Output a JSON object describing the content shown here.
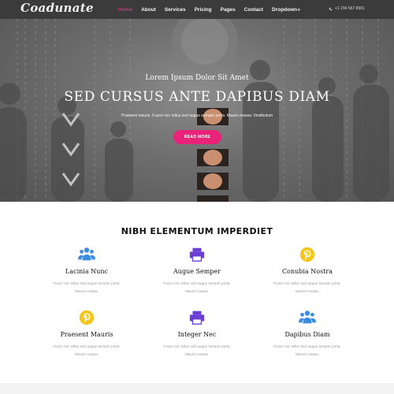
{
  "brand": {
    "logo": "Coadunate",
    "accent": "#e9237a",
    "nav_bg": "#3c3b3c"
  },
  "nav": {
    "items": [
      {
        "label": "Home",
        "active": true
      },
      {
        "label": "About"
      },
      {
        "label": "Services"
      },
      {
        "label": "Pricing"
      },
      {
        "label": "Pages"
      },
      {
        "label": "Contact"
      },
      {
        "label": "Dropdown"
      }
    ],
    "dropdown_caret": "▾",
    "phone": "+1 234 567 8901",
    "phone_icon": "phone-icon"
  },
  "hero": {
    "subtitle": "Lorem Ipsum Dolor Sit Amet",
    "title": "SED CURSUS ANTE DAPIBUS DIAM",
    "description": "Praesent mauris. Fusce nec tellus sed augue semper porta. Mauris massa. Vestibulum",
    "button_label": "READ MORE"
  },
  "features": {
    "title": "NIBH ELEMENTUM IMPERDIET",
    "items": [
      {
        "name": "Lacinia Nunc",
        "icon": "users-icon",
        "color": "#3a8de0",
        "desc": "Fusce nec tellus sed augue semper porta. Mauris massa."
      },
      {
        "name": "Augue Semper",
        "icon": "printer-icon",
        "color": "#6b3fd6",
        "desc": "Fusce nec tellus sed augue semper porta. Mauris massa."
      },
      {
        "name": "Conubia Nostra",
        "icon": "pinterest-icon",
        "color": "#f4c61a",
        "desc": "Fusce nec tellus sed augue semper porta. Mauris massa."
      },
      {
        "name": "Praesent Mauris",
        "icon": "pinterest-icon",
        "color": "#f4c61a",
        "desc": "Fusce nec tellus sed augue semper porta. Mauris massa."
      },
      {
        "name": "Integer Nec",
        "icon": "printer-icon",
        "color": "#6b3fd6",
        "desc": "Fusce nec tellus sed augue semper porta. Mauris massa."
      },
      {
        "name": "Dapibus Diam",
        "icon": "users-icon",
        "color": "#3a8de0",
        "desc": "Fusce nec tellus sed augue semper porta. Mauris massa."
      }
    ]
  }
}
